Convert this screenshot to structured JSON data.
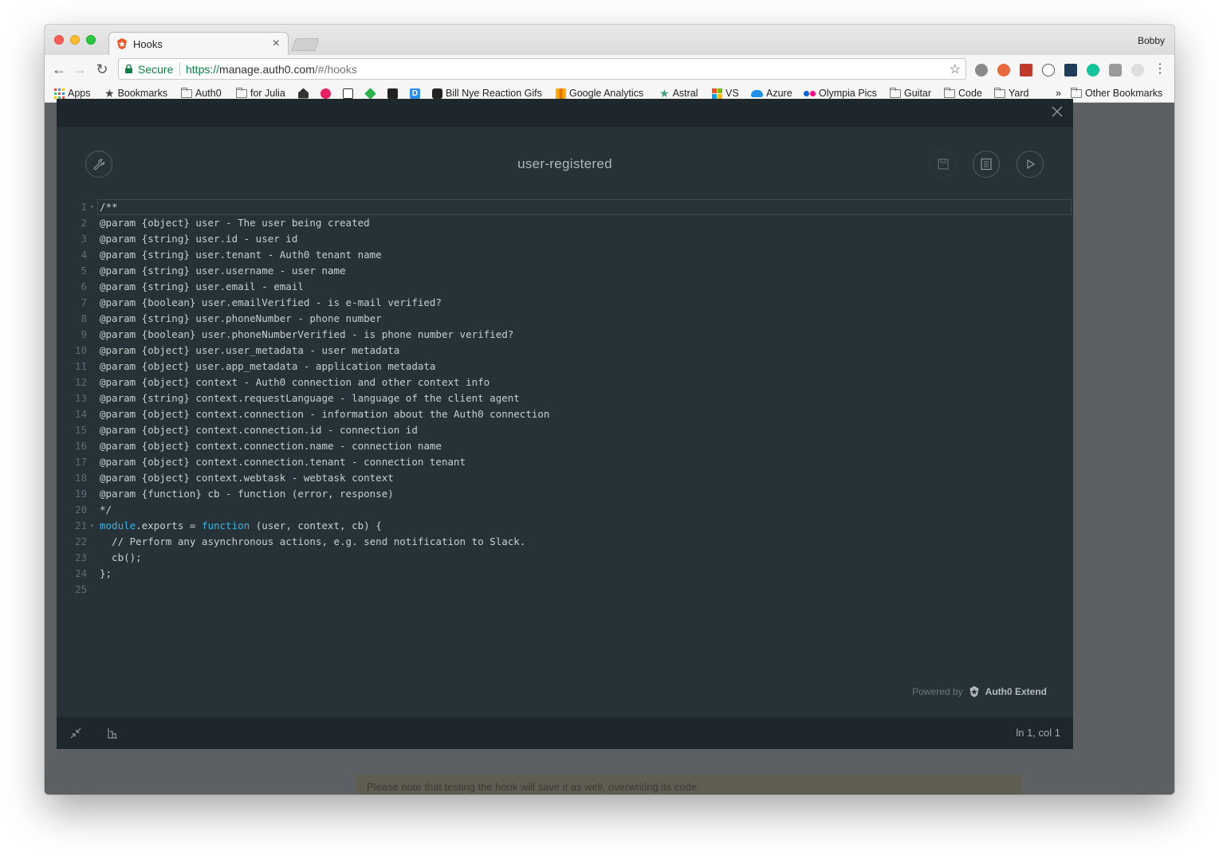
{
  "browser": {
    "tab_title": "Hooks",
    "tab_close": "×",
    "profile_name": "Bobby",
    "secure_label": "Secure",
    "url_scheme": "https://",
    "url_host": "manage.auth0.com",
    "url_path": "/#/hooks",
    "star_glyph": "☆",
    "back_glyph": "←",
    "forward_glyph": "→",
    "reload_glyph": "↻",
    "menu_glyph": "⋮"
  },
  "bookmarks": [
    {
      "label": "Apps",
      "icon": "apps-grid-icon"
    },
    {
      "label": "Bookmarks",
      "icon": "star-icon"
    },
    {
      "label": "Auth0",
      "icon": "folder-icon"
    },
    {
      "label": "for Julia",
      "icon": "folder-icon"
    },
    {
      "label": "",
      "icon": "home-icon"
    },
    {
      "label": "",
      "icon": "play-icon"
    },
    {
      "label": "",
      "icon": "download-icon"
    },
    {
      "label": "",
      "icon": "feedly-icon"
    },
    {
      "label": "",
      "icon": "bookmark-app-icon"
    },
    {
      "label": "",
      "icon": "d-icon"
    },
    {
      "label": "Bill Nye Reaction Gifs",
      "icon": "gif-icon"
    },
    {
      "label": "Google Analytics",
      "icon": "analytics-icon"
    },
    {
      "label": "Astral",
      "icon": "star-icon"
    },
    {
      "label": "VS",
      "icon": "windows-icon"
    },
    {
      "label": "Azure",
      "icon": "cloud-icon"
    },
    {
      "label": "Olympia Pics",
      "icon": "flickr-icon"
    },
    {
      "label": "Guitar",
      "icon": "folder-icon"
    },
    {
      "label": "Code",
      "icon": "folder-icon"
    },
    {
      "label": "Yard",
      "icon": "folder-icon"
    }
  ],
  "bookmarks_overflow": "»",
  "other_bookmarks": "Other Bookmarks",
  "page": {
    "note_text": "Please note that testing the hook will save it as well, overwriting its code."
  },
  "modal": {
    "title": "user-registered",
    "status_position": "ln 1, col 1",
    "powered_by": "Powered by",
    "brand": "Auth0 Extend"
  },
  "editor": {
    "active_line": 1,
    "lines": [
      {
        "n": "1",
        "fold": true,
        "text": "/**"
      },
      {
        "n": "2",
        "text": "@param {object} user - The user being created"
      },
      {
        "n": "3",
        "text": "@param {string} user.id - user id"
      },
      {
        "n": "4",
        "text": "@param {string} user.tenant - Auth0 tenant name"
      },
      {
        "n": "5",
        "text": "@param {string} user.username - user name"
      },
      {
        "n": "6",
        "text": "@param {string} user.email - email"
      },
      {
        "n": "7",
        "text": "@param {boolean} user.emailVerified - is e-mail verified?"
      },
      {
        "n": "8",
        "text": "@param {string} user.phoneNumber - phone number"
      },
      {
        "n": "9",
        "text": "@param {boolean} user.phoneNumberVerified - is phone number verified?"
      },
      {
        "n": "10",
        "text": "@param {object} user.user_metadata - user metadata"
      },
      {
        "n": "11",
        "text": "@param {object} user.app_metadata - application metadata"
      },
      {
        "n": "12",
        "text": "@param {object} context - Auth0 connection and other context info"
      },
      {
        "n": "13",
        "text": "@param {string} context.requestLanguage - language of the client agent"
      },
      {
        "n": "14",
        "text": "@param {object} context.connection - information about the Auth0 connection"
      },
      {
        "n": "15",
        "text": "@param {object} context.connection.id - connection id"
      },
      {
        "n": "16",
        "text": "@param {object} context.connection.name - connection name"
      },
      {
        "n": "17",
        "text": "@param {object} context.connection.tenant - connection tenant"
      },
      {
        "n": "18",
        "text": "@param {object} context.webtask - webtask context"
      },
      {
        "n": "19",
        "text": "@param {function} cb - function (error, response)"
      },
      {
        "n": "20",
        "text": "*/"
      },
      {
        "n": "21",
        "fold": true,
        "parts": [
          {
            "t": "module",
            "kw": true
          },
          {
            "t": ".exports = "
          },
          {
            "t": "function",
            "kw": true
          },
          {
            "t": " (user, context, cb) {"
          }
        ]
      },
      {
        "n": "22",
        "text": "  // Perform any asynchronous actions, e.g. send notification to Slack."
      },
      {
        "n": "23",
        "text": "  cb();"
      },
      {
        "n": "24",
        "text": "};"
      },
      {
        "n": "25",
        "text": ""
      }
    ]
  },
  "colors": {
    "editor_bg": "#263238",
    "keyword": "#36b4e5",
    "secure_green": "#0b8043"
  }
}
